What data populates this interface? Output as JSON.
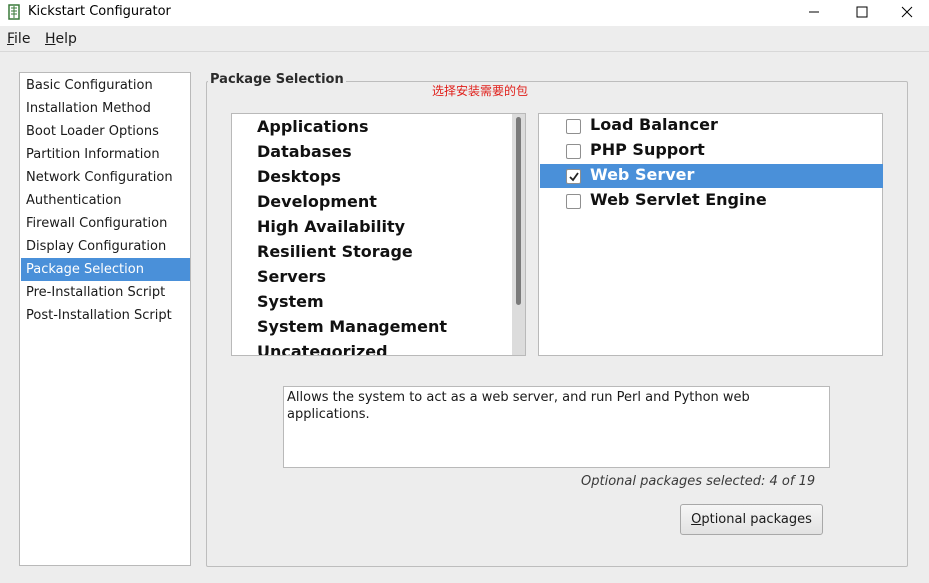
{
  "window": {
    "title": "Kickstart Configurator"
  },
  "menubar": {
    "file": {
      "mnemonic": "F",
      "rest": "ile"
    },
    "help": {
      "mnemonic": "H",
      "rest": "elp"
    }
  },
  "sidebar": {
    "items": [
      {
        "label": "Basic Configuration"
      },
      {
        "label": "Installation Method"
      },
      {
        "label": "Boot Loader Options"
      },
      {
        "label": "Partition Information"
      },
      {
        "label": "Network Configuration"
      },
      {
        "label": "Authentication"
      },
      {
        "label": "Firewall Configuration"
      },
      {
        "label": "Display Configuration"
      },
      {
        "label": "Package Selection"
      },
      {
        "label": "Pre-Installation Script"
      },
      {
        "label": "Post-Installation Script"
      }
    ],
    "selected": "Package Selection"
  },
  "main": {
    "frame_title": "Package Selection",
    "annotation": "选择安装需要的包",
    "groups": [
      {
        "label": "Applications"
      },
      {
        "label": "Databases"
      },
      {
        "label": "Desktops"
      },
      {
        "label": "Development"
      },
      {
        "label": "High Availability"
      },
      {
        "label": "Resilient Storage"
      },
      {
        "label": "Servers"
      },
      {
        "label": "System"
      },
      {
        "label": "System Management"
      },
      {
        "label": "Uncategorized"
      }
    ],
    "packages": [
      {
        "label": "Load Balancer",
        "checked": false
      },
      {
        "label": "PHP Support",
        "checked": false
      },
      {
        "label": "Web Server",
        "checked": true
      },
      {
        "label": "Web Servlet Engine",
        "checked": false
      }
    ],
    "selected_package": "Web Server",
    "description": "Allows the system to act as a web server, and run Perl and Python web applications.",
    "status": "Optional packages selected: 4 of 19",
    "optional_button": {
      "mnemonic": "O",
      "rest": "ptional packages"
    }
  },
  "colors": {
    "selection": "#4a90d9",
    "annotation": "#e0201b"
  }
}
